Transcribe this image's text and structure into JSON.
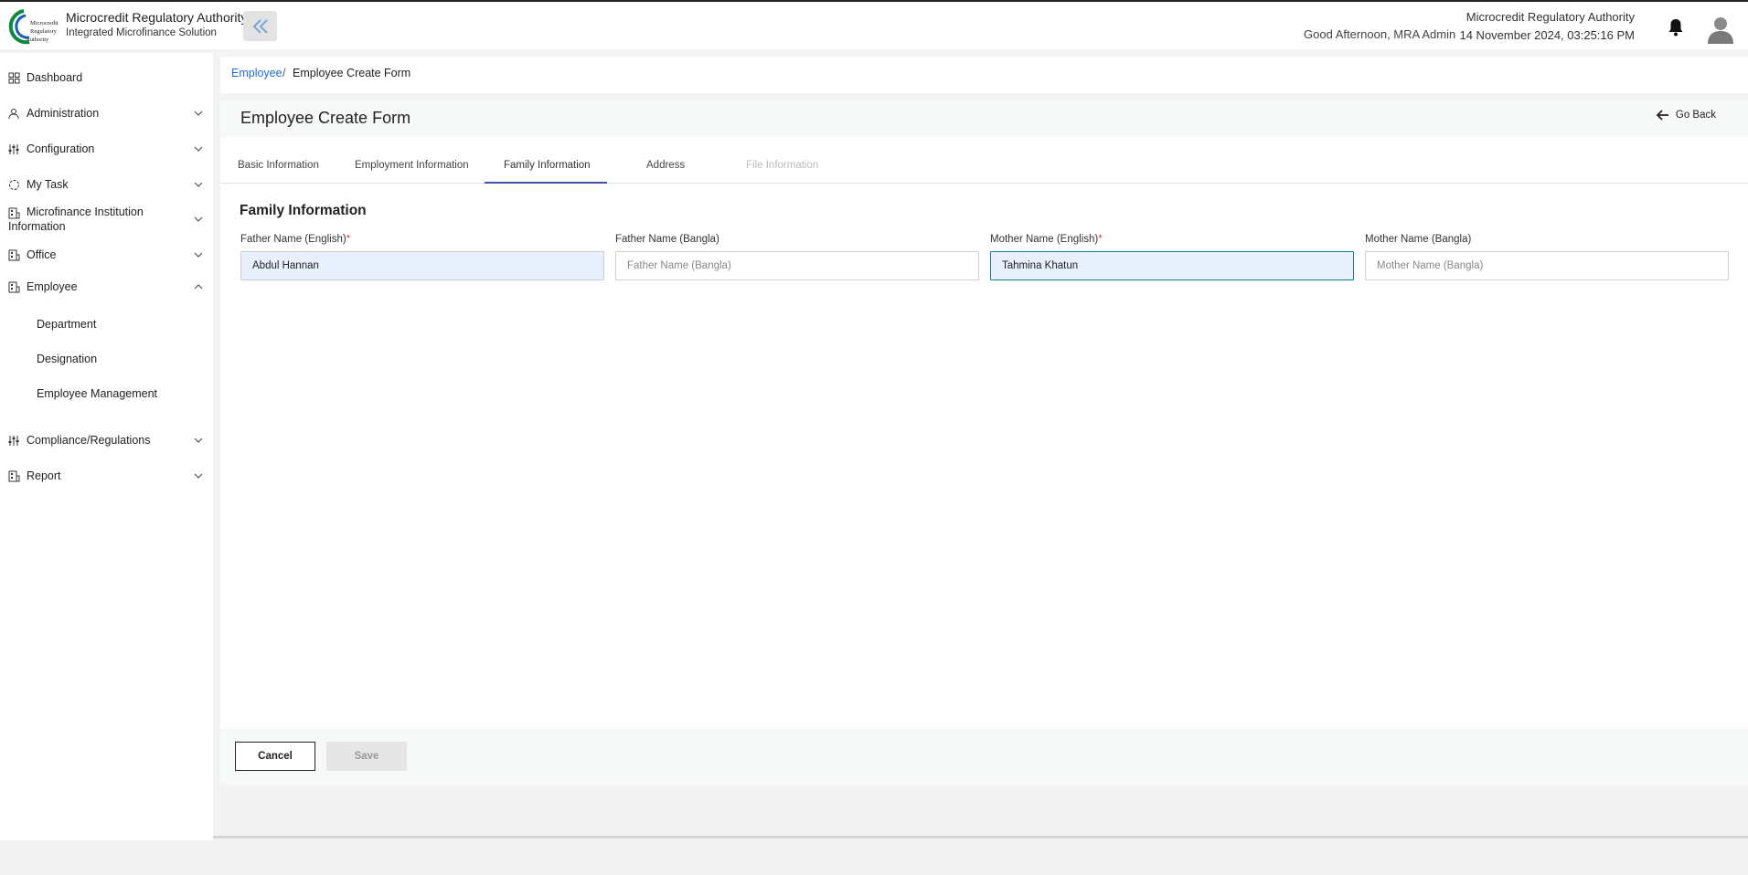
{
  "header": {
    "brand_title": "Microcredit Regulatory Authority",
    "brand_subtitle": "Integrated Microfinance Solution",
    "logo_text": [
      "Microcredit",
      "Regulatory",
      "Authority"
    ],
    "greeting": "Good Afternoon, MRA Admin",
    "org_name": "Microcredit Regulatory Authority",
    "datetime": "14 November 2024, 03:25:16 PM",
    "icons": [
      "double-chevron-left-icon",
      "bell-icon",
      "user-avatar-icon"
    ]
  },
  "sidebar": {
    "items": [
      {
        "label": "Dashboard",
        "icon": "grid-icon",
        "expandable": false
      },
      {
        "label": "Administration",
        "icon": "users-gear-icon",
        "expandable": true
      },
      {
        "label": "Configuration",
        "icon": "sliders-icon",
        "expandable": true
      },
      {
        "label": "My Task",
        "icon": "circle-dashed-icon",
        "expandable": true
      },
      {
        "label": "Microfinance Institution Information",
        "icon": "building-icon",
        "expandable": true
      },
      {
        "label": "Office",
        "icon": "building-icon",
        "expandable": true
      },
      {
        "label": "Employee",
        "icon": "building-icon",
        "expandable": true,
        "expanded": true
      },
      {
        "label": "Compliance/Regulations",
        "icon": "sliders-icon",
        "expandable": true
      },
      {
        "label": "Report",
        "icon": "building-icon",
        "expandable": true
      }
    ],
    "employee_subitems": [
      "Department",
      "Designation",
      "Employee Management"
    ]
  },
  "breadcrumb": {
    "link": "Employee",
    "separator": "/",
    "current": "Employee Create Form"
  },
  "form": {
    "title": "Employee Create Form",
    "go_back": "Go Back",
    "tabs": [
      {
        "label": "Basic Information",
        "state": "normal"
      },
      {
        "label": "Employment Information",
        "state": "normal"
      },
      {
        "label": "Family Information",
        "state": "active"
      },
      {
        "label": "Address",
        "state": "normal"
      },
      {
        "label": "File Information",
        "state": "disabled"
      }
    ],
    "section_title": "Family Information",
    "fields": [
      {
        "label": "Father Name (English)",
        "required": true,
        "value": "Abdul Hannan",
        "placeholder": "Father Name (English)"
      },
      {
        "label": "Father Name (Bangla)",
        "required": false,
        "value": "",
        "placeholder": "Father Name (Bangla)"
      },
      {
        "label": "Mother Name (English)",
        "required": true,
        "value": "Tahmina Khatun",
        "placeholder": "Mother Name (English)"
      },
      {
        "label": "Mother Name (Bangla)",
        "required": false,
        "value": "",
        "placeholder": "Mother Name (Bangla)"
      }
    ],
    "required_marker": "*",
    "cancel_label": "Cancel",
    "save_label": "Save"
  },
  "colors": {
    "accent": "#3f51b5",
    "link": "#1d6fd6",
    "required": "#e53935",
    "input_filled_bg": "#e8f0fe",
    "focus_border": "#1a7ba3"
  }
}
